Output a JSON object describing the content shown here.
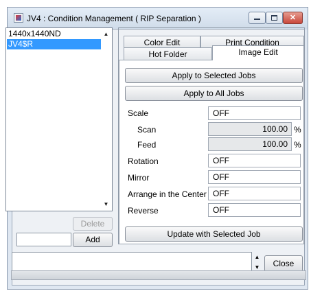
{
  "window": {
    "title": "JV4 : Condition Management ( RIP Separation )",
    "controls": {
      "minimize_icon": "minimize-icon",
      "maximize_icon": "maximize-icon",
      "close_icon": "close-icon"
    }
  },
  "left_list": {
    "items": [
      "1440x1440ND",
      "JV4$R"
    ],
    "selected_index": 1,
    "delete_label": "Delete",
    "add_label": "Add",
    "name_input_value": ""
  },
  "tabs": {
    "row1": [
      "Color Edit",
      "Print Condition"
    ],
    "row2": [
      "Hot Folder",
      "Image Edit"
    ],
    "active": "Image Edit"
  },
  "image_edit": {
    "apply_selected_label": "Apply to Selected Jobs",
    "apply_all_label": "Apply to All Jobs",
    "fields": {
      "scale": {
        "label": "Scale",
        "value": "OFF"
      },
      "scan": {
        "label": "Scan",
        "value": "100.00",
        "unit": "%"
      },
      "feed": {
        "label": "Feed",
        "value": "100.00",
        "unit": "%"
      },
      "rotation": {
        "label": "Rotation",
        "value": "OFF"
      },
      "mirror": {
        "label": "Mirror",
        "value": "OFF"
      },
      "arrange_center": {
        "label": "Arrange in the Center",
        "value": "OFF"
      },
      "reverse": {
        "label": "Reverse",
        "value": "OFF"
      }
    },
    "update_label": "Update with Selected Job"
  },
  "footer": {
    "message_value": "",
    "close_label": "Close"
  },
  "colors": {
    "selection": "#3399ff",
    "close_button": "#c9473b"
  }
}
